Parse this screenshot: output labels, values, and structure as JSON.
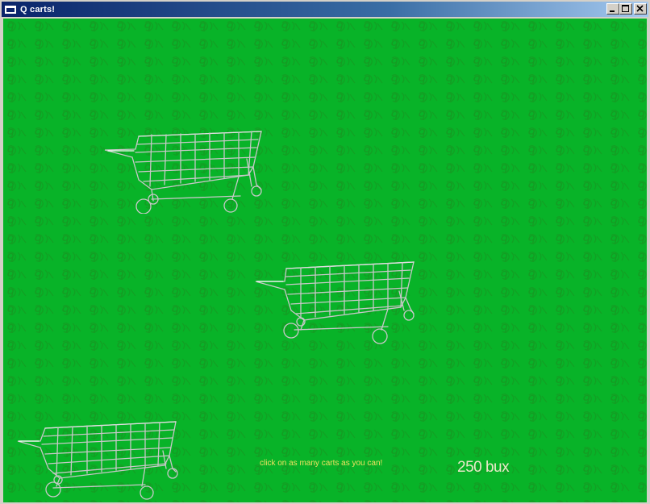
{
  "window": {
    "title": "Q carts!",
    "buttons": {
      "minimize": "0",
      "maximize": "1",
      "close": "r"
    }
  },
  "game": {
    "background_color": "#08b328",
    "pattern_color": "#1d8f1d",
    "cart_count": 3,
    "hint_text": "click on as many carts as you can!",
    "hint_color": "#f0e060",
    "score_text": "250 bux",
    "score_color": "#e8e8c8"
  },
  "icons": {
    "cart": "shopping-cart-icon"
  }
}
